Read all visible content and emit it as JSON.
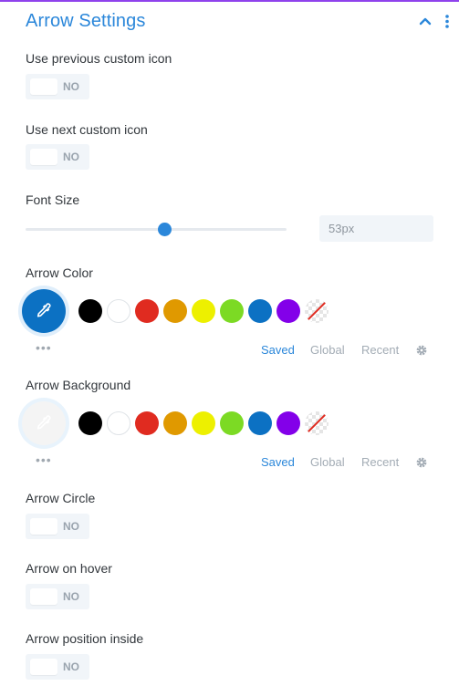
{
  "header": {
    "title": "Arrow Settings"
  },
  "toggles": {
    "use_previous": {
      "label": "Use previous custom icon",
      "value": "NO"
    },
    "use_next": {
      "label": "Use next custom icon",
      "value": "NO"
    },
    "arrow_circle": {
      "label": "Arrow Circle",
      "value": "NO"
    },
    "arrow_hover": {
      "label": "Arrow on hover",
      "value": "NO"
    },
    "arrow_inside": {
      "label": "Arrow position inside",
      "value": "NO"
    }
  },
  "font_size": {
    "label": "Font Size",
    "value": "53px",
    "slider_fraction": 0.53
  },
  "arrow_color": {
    "label": "Arrow Color",
    "selected": "#0c71c3",
    "picker_icon": "eyedropper-icon"
  },
  "arrow_background": {
    "label": "Arrow Background",
    "selected": "",
    "picker_icon": "eyedropper-icon"
  },
  "palette": {
    "swatches": [
      {
        "name": "black",
        "color": "#000000"
      },
      {
        "name": "white",
        "color": "#ffffff"
      },
      {
        "name": "red",
        "color": "#e02b20"
      },
      {
        "name": "orange",
        "color": "#e09900"
      },
      {
        "name": "yellow",
        "color": "#edf000"
      },
      {
        "name": "green",
        "color": "#7cda24"
      },
      {
        "name": "blue",
        "color": "#0c71c3"
      },
      {
        "name": "purple",
        "color": "#8300e9"
      },
      {
        "name": "none",
        "color": "transparent"
      }
    ],
    "more": "•••",
    "tabs": {
      "saved": "Saved",
      "global": "Global",
      "recent": "Recent"
    },
    "settings_icon": "gear-icon"
  },
  "colors": {
    "accent": "#2b87da",
    "header_line": "#8f42ec"
  }
}
